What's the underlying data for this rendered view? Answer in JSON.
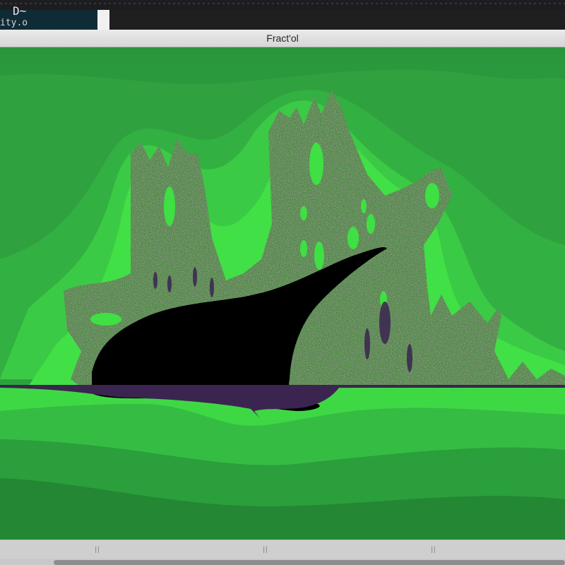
{
  "background": {
    "terminal_glyph": "D~",
    "terminal_filename": "ity.o"
  },
  "window": {
    "title": "Fract'ol"
  },
  "canvas": {
    "description_colors": {
      "base": "#2b9b3d",
      "band_dark": "#218a34",
      "band_mid": "#3fbd45",
      "band_light": "#3ee043",
      "set": "#000000",
      "noise_purple": "#3b2450",
      "noise_red": "#c0392b"
    }
  },
  "bottombar": {
    "handle_glyph": "||"
  },
  "colors": {
    "titlebar": "#e0e0e0",
    "bottombar": "#cfcfcf",
    "scroll_thumb": "#8d8d8d"
  }
}
